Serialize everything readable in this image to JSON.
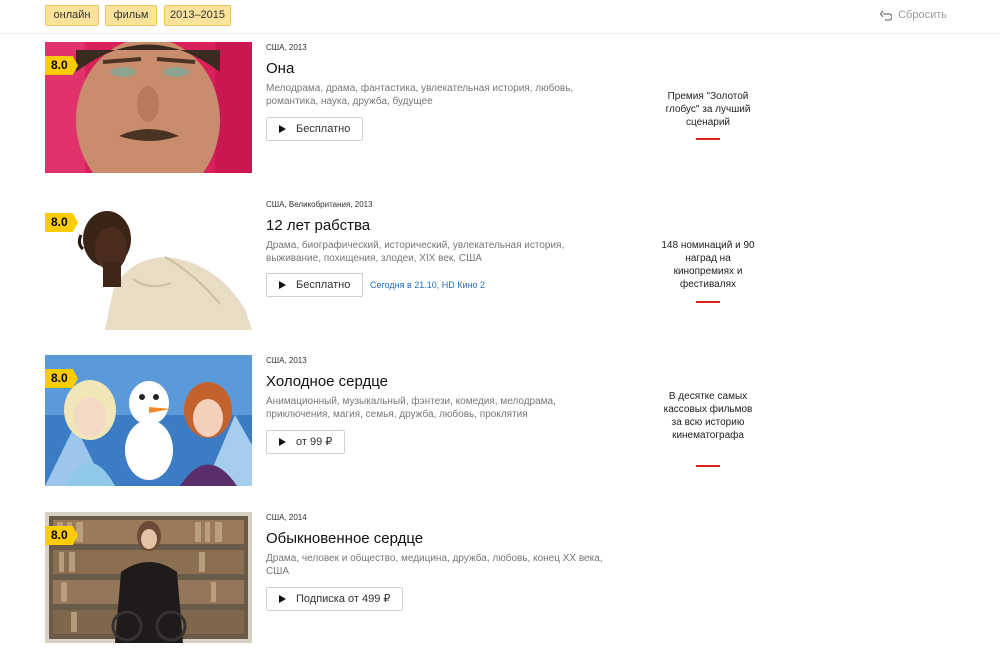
{
  "filters": {
    "chips": [
      "онлайн",
      "фильм",
      "2013–2015"
    ],
    "reset_label": "Сбросить"
  },
  "movies": [
    {
      "rating": "8.0",
      "meta": "США, 2013",
      "title": "Она",
      "genres": "Мелодрама, драма, фантастика, увлекательная история, любовь, романтика, наука, дружба, будущее",
      "button_label": "Бесплатно",
      "tv_info": "",
      "award": "Премия \"Золотой глобус\" за лучший сценарий"
    },
    {
      "rating": "8.0",
      "meta": "США, Великобритания, 2013",
      "title": "12 лет рабства",
      "genres": "Драма, биографический, исторический, увлекательная история, выживание, похищения, злодеи, XIX век, США",
      "button_label": "Бесплатно",
      "tv_info": "Сегодня в 21.10, HD Кино 2",
      "award": "148 номинаций и 90 наград на кинопремиях и фестивалях"
    },
    {
      "rating": "8.0",
      "meta": "США, 2013",
      "title": "Холодное сердце",
      "genres": "Анимационный, музыкальный, фэнтези, комедия, мелодрама, приключения, магия, семья, дружба, любовь, проклятия",
      "button_label": "от 99 ₽",
      "tv_info": "",
      "award": "В десятке самых кассовых фильмов за всю историю кинематографа"
    },
    {
      "rating": "8.0",
      "meta": "США, 2014",
      "title": "Обыкновенное сердце",
      "genres": "Драма, человек и общество, медицина, дружба, любовь, конец XX века, США",
      "button_label": "Подписка от 499 ₽",
      "tv_info": "",
      "award": ""
    }
  ],
  "colors": {
    "chip_bg": "#fbe39b",
    "rating_badge": "#ffcc00",
    "tv_link": "#1f6fba",
    "award_underline": "#e0201c"
  },
  "icons": {
    "reset": "undo-arrow-icon",
    "play": "play-triangle-icon"
  }
}
